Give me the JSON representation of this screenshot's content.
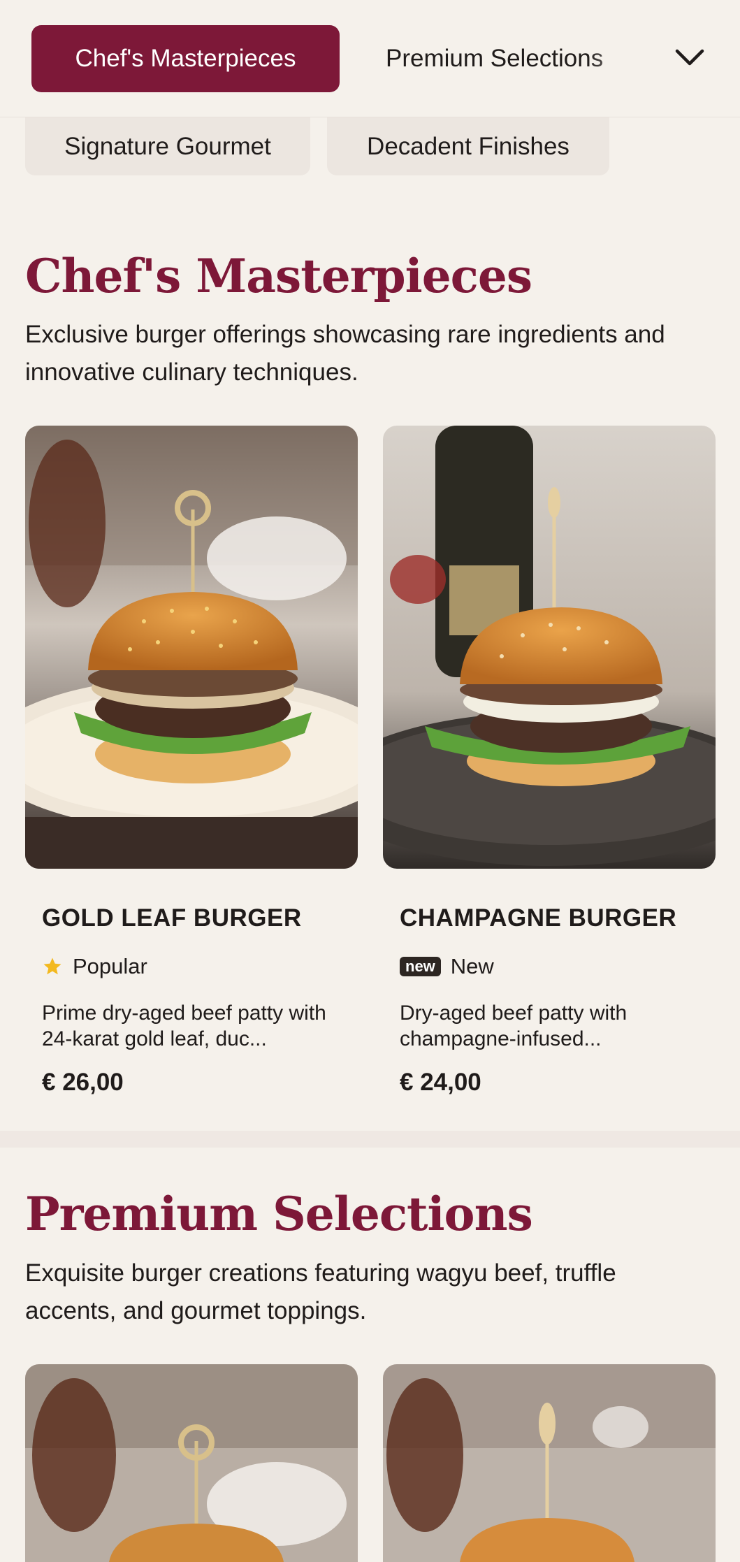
{
  "nav": {
    "active_category": "Chef's Masterpieces",
    "next_category": "Premium Selections",
    "row2": [
      "Signature Gourmet",
      "Decadent Finishes"
    ]
  },
  "sections": [
    {
      "title": "Chef's Masterpieces",
      "description": "Exclusive burger offerings showcasing rare ingredients and innovative culinary techniques.",
      "items": [
        {
          "name": "GOLD LEAF BURGER",
          "badge_icon": "star-icon",
          "badge_label": "Popular",
          "description": "Prime dry-aged beef patty with 24-karat gold leaf, duc...",
          "price": "€ 26,00"
        },
        {
          "name": "CHAMPAGNE BURGER",
          "badge_tag": "new",
          "badge_label": "New",
          "description": "Dry-aged beef patty with champagne-infused...",
          "price": "€ 24,00"
        }
      ]
    },
    {
      "title": "Premium Selections",
      "description": "Exquisite burger creations featuring wagyu beef, truffle accents, and gourmet toppings."
    }
  ],
  "colors": {
    "accent": "#7d1838",
    "background": "#f5f1eb",
    "pill_secondary": "#ece6e0"
  }
}
